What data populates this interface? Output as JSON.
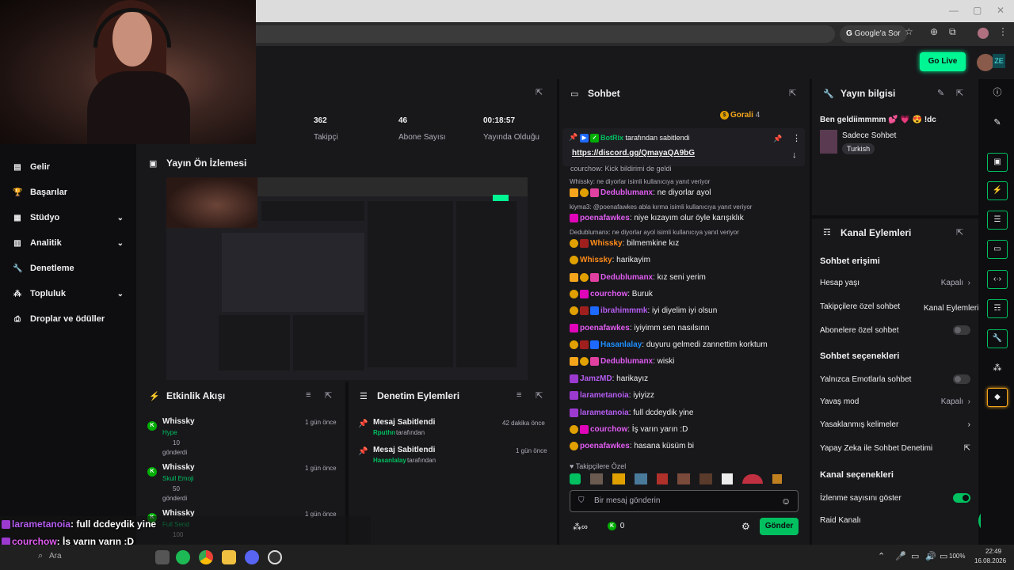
{
  "browser": {
    "google_pill": "Google'a Sor"
  },
  "topbar": {
    "go_live": "Go Live"
  },
  "leftnav": {
    "items": [
      {
        "label": "Gelir",
        "icon": "money-icon",
        "chevron": false
      },
      {
        "label": "Başarılar",
        "icon": "trophy-icon",
        "chevron": false
      },
      {
        "label": "Stüdyo",
        "icon": "studio-icon",
        "chevron": true
      },
      {
        "label": "Analitik",
        "icon": "analytics-icon",
        "chevron": true
      },
      {
        "label": "Denetleme",
        "icon": "wrench-icon",
        "chevron": false
      },
      {
        "label": "Topluluk",
        "icon": "community-icon",
        "chevron": true
      },
      {
        "label": "Droplar ve ödüller",
        "icon": "gift-icon",
        "chevron": false
      }
    ]
  },
  "stats": {
    "items": [
      {
        "value": "362",
        "label": "Takipçi"
      },
      {
        "value": "46",
        "label": "Abone Sayısı"
      },
      {
        "value": "00:18:57",
        "label": "Yayında Olduğu"
      }
    ]
  },
  "preview": {
    "title": "Yayın Ön İzlemesi"
  },
  "activity": {
    "title": "Etkinlik Akışı",
    "items": [
      {
        "user": "Whissky",
        "item": "Hype",
        "amount": "10",
        "action": "gönderdi",
        "time": "1 gün önce"
      },
      {
        "user": "Whissky",
        "item": "Skull Emoji",
        "amount": "50",
        "action": "gönderdi",
        "time": "1 gün önce"
      },
      {
        "user": "Whissky",
        "item": "Full Send",
        "amount": "100",
        "action": "",
        "time": "1 gün önce"
      }
    ]
  },
  "modlog": {
    "title": "Denetim Eylemleri",
    "items": [
      {
        "action": "Mesaj Sabitlendi",
        "user": "Rputhn",
        "suffix": "tarafından",
        "time": "42 dakika önce"
      },
      {
        "action": "Mesaj Sabitlendi",
        "user": "Hasanlalay",
        "suffix": "tarafından",
        "time": "1 gün önce"
      }
    ]
  },
  "chat": {
    "title": "Sohbet",
    "gorali_label": "Gorali",
    "gorali_count": "4",
    "pinned_by": "BotRix",
    "pinned_suffix": "tarafından sabitlendi",
    "pinned_link": "https://discord.gg/QmayaQA9bG",
    "partial_line": "courchow: Kick bildirimi de geldi",
    "lines": [
      {
        "reply": "Whissky: ne diyorlar isimli kullanıcıya yanıt veriyor",
        "user": "Dedublumanx",
        "color": "#e05cf0",
        "msg": ": ne diyorlar ayol"
      },
      {
        "reply": "kiyma3: @poenafawkes abla kırma isimli kullanıcıya yanıt veriyor",
        "user": "poenafawkes",
        "color": "#e05cf0",
        "msg": ": niye kızayım olur öyle karışıklık"
      },
      {
        "reply": "Dedublumanx: ne diyorlar ayol isimli kullanıcıya yanıt veriyor",
        "user": "Whissky",
        "color": "#ff8c1a",
        "msg": ": bilmemkine kız"
      },
      {
        "reply": "",
        "user": "Whissky",
        "color": "#ff8c1a",
        "msg": ": harikayim"
      },
      {
        "reply": "",
        "user": "Dedublumanx",
        "color": "#e05cf0",
        "msg": ": kız seni yerim"
      },
      {
        "reply": "",
        "user": "courchow",
        "color": "#e05cf0",
        "msg": ": Buruk"
      },
      {
        "reply": "",
        "user": "ibrahimmmk",
        "color": "#b45cf0",
        "msg": ": iyi diyelim iyi olsun"
      },
      {
        "reply": "",
        "user": "poenafawkes",
        "color": "#e05cf0",
        "msg": ": iyiyimm sen nasılsınn"
      },
      {
        "reply": "",
        "user": "Hasanlalay",
        "color": "#1e90ff",
        "msg": ": duyuru gelmedi zannettim korktum"
      },
      {
        "reply": "",
        "user": "Dedublumanx",
        "color": "#e05cf0",
        "msg": ": wiski"
      },
      {
        "reply": "",
        "user": "JamzMD",
        "color": "#b45cf0",
        "msg": ": harikayız"
      },
      {
        "reply": "",
        "user": "larametanoia",
        "color": "#b45cf0",
        "msg": ": iyiyizz"
      },
      {
        "reply": "",
        "user": "larametanoia",
        "color": "#b45cf0",
        "msg": ": full dcdeydik yine"
      },
      {
        "reply": "",
        "user": "courchow",
        "color": "#e05cf0",
        "msg": ": İş varın yarın :D"
      },
      {
        "reply": "",
        "user": "poenafawkes",
        "color": "#e05cf0",
        "msg": ": hasana küsüm bi"
      }
    ],
    "followers_only": "Takipçilere Özel",
    "input_placeholder": "Bir mesaj gönderin",
    "points": "0",
    "send_label": "Gönder"
  },
  "streaminfo": {
    "title": "Yayın bilgisi",
    "stream_title": "Ben geldiimmmm 💕 💗 😍 !dc",
    "category": "Sadece Sohbet",
    "tag": "Turkish"
  },
  "channel_actions": {
    "title": "Kanal Eylemleri",
    "section1": "Sohbet erişimi",
    "hesap_yasi": "Hesap yaşı",
    "hesap_yasi_val": "Kapalı",
    "takipci_ozel": "Takipçilere özel sohbet",
    "takipci_ozel_val": "Kanal Eylemleri",
    "abone_ozel": "Abonelere özel sohbet",
    "section2": "Sohbet seçenekleri",
    "emote_only": "Yalnızca Emotlarla sohbet",
    "slow_mode": "Yavaş mod",
    "slow_mode_val": "Kapalı",
    "banned_words": "Yasaklanmış kelimeler",
    "ai_mod": "Yapay Zeka ile Sohbet Denetimi",
    "section3": "Kanal seçenekleri",
    "show_viewers": "İzlenme sayısını göster",
    "raid": "Raid Kanalı"
  },
  "overlay": {
    "lines": [
      {
        "user": "larametanoia",
        "color": "#b45cf0",
        "msg": ": full dcdeydik yine"
      },
      {
        "user": "courchow",
        "color": "#e05cf0",
        "msg": ": İş varın yarın :D"
      },
      {
        "user": "poenafawkes",
        "color": "#e05cf0",
        "msg": ": hasana küsüm bi"
      }
    ]
  },
  "taskbar": {
    "search": "Ara",
    "battery": "100%",
    "time": "22:49",
    "date": "16.08.2026"
  },
  "colors": {
    "accent": "#00c060",
    "golive": "#00f593",
    "panel": "#18181b",
    "bg": "#0e0e10"
  }
}
